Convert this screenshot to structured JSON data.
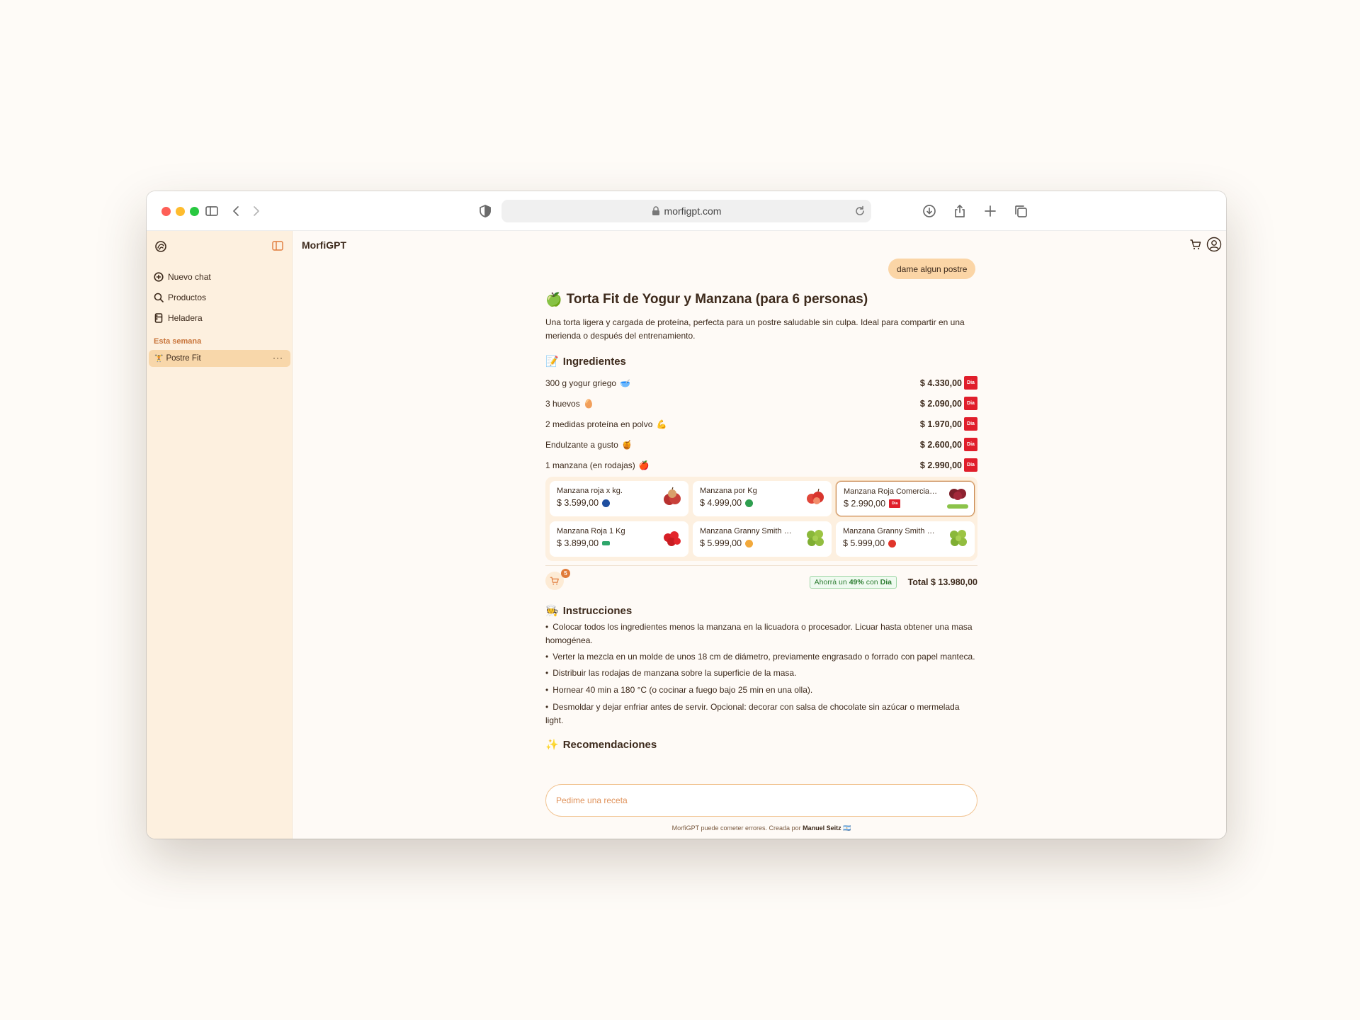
{
  "browser": {
    "url": "morfigpt.com"
  },
  "sidebar": {
    "nav": [
      {
        "label": "Nuevo chat",
        "icon": "new-chat-icon"
      },
      {
        "label": "Productos",
        "icon": "search-icon"
      },
      {
        "label": "Heladera",
        "icon": "fridge-icon"
      }
    ],
    "section_label": "Esta semana",
    "chats": [
      {
        "label": "Postre Fit",
        "emoji": "🏋",
        "menu": "···"
      }
    ]
  },
  "main": {
    "title": "MorfiGPT",
    "user_message": "dame algun postre",
    "recipe": {
      "title_emoji": "🍏",
      "title": "Torta Fit de Yogur y Manzana (para 6 personas)",
      "intro": "Una torta ligera y cargada de proteína, perfecta para un postre saludable sin culpa. Ideal para compartir en una merienda o después del entrenamiento.",
      "ingredients_emoji": "📝",
      "ingredients_heading": "Ingredientes",
      "ingredients": [
        {
          "name": "300 g yogur griego",
          "emoji": "🥣",
          "price": "$ 4.330,00",
          "store": "Dia"
        },
        {
          "name": "3 huevos",
          "emoji": "🥚",
          "price": "$ 2.090,00",
          "store": "Dia"
        },
        {
          "name": "2 medidas proteína en polvo",
          "emoji": "💪",
          "price": "$ 1.970,00",
          "store": "Dia"
        },
        {
          "name": "Endulzante a gusto",
          "emoji": "🍯",
          "price": "$ 2.600,00",
          "store": "Dia"
        },
        {
          "name": "1 manzana (en rodajas)",
          "emoji": "🍎",
          "price": "$ 2.990,00",
          "store": "Dia"
        }
      ],
      "alternatives": [
        {
          "name": "Manzana roja x kg.",
          "price": "$ 3.599,00",
          "store_color": "#1f4fa0",
          "selected": false,
          "fruit": "red"
        },
        {
          "name": "Manzana por Kg",
          "price": "$ 4.999,00",
          "store_color": "#2e9e4f",
          "selected": false,
          "fruit": "red"
        },
        {
          "name": "Manzana Roja Comercial e...",
          "price": "$ 2.990,00",
          "store_color": "#e01e2b",
          "selected": true,
          "fruit": "darkred"
        },
        {
          "name": "Manzana Roja 1 Kg",
          "price": "$ 3.899,00",
          "store_color": "#2ea66b",
          "selected": false,
          "fruit": "red"
        },
        {
          "name": "Manzana Granny Smith po...",
          "price": "$ 5.999,00",
          "store_color": "#f2a93b",
          "selected": false,
          "fruit": "green"
        },
        {
          "name": "Manzana Granny Smith po...",
          "price": "$ 5.999,00",
          "store_color": "#e0352b",
          "selected": false,
          "fruit": "green"
        }
      ],
      "cart_count": "5",
      "savings_prefix": "Ahorrá un",
      "savings_percent": "49%",
      "savings_mid": "con",
      "savings_store": "Dia",
      "total": "Total $ 13.980,00",
      "instructions_emoji": "🧑‍🍳",
      "instructions_heading": "Instrucciones",
      "instructions": [
        "Colocar todos los ingredientes menos la manzana en la licuadora o procesador. Licuar hasta obtener una masa homogénea.",
        "Verter la mezcla en un molde de unos 18 cm de diámetro, previamente engrasado o forrado con papel manteca.",
        "Distribuir las rodajas de manzana sobre la superficie de la masa.",
        "Hornear 40 min a 180 °C (o cocinar a fuego bajo 25 min en una olla).",
        "Desmoldar y dejar enfriar antes de servir. Opcional: decorar con salsa de chocolate sin azúcar o mermelada light."
      ],
      "recommendations_emoji": "✨",
      "recommendations_heading": "Recomendaciones"
    },
    "input_placeholder": "Pedime una receta",
    "footer_text": "MorfiGPT puede cometer errores. Creada por",
    "footer_author": "Manuel Seitz",
    "footer_flag": "🇦🇷"
  },
  "colors": {
    "accent": "#e07b3a",
    "dia_red": "#e01e2b",
    "sidebar_bg": "#fdf0df",
    "chat_pill": "#fbd5a6"
  }
}
